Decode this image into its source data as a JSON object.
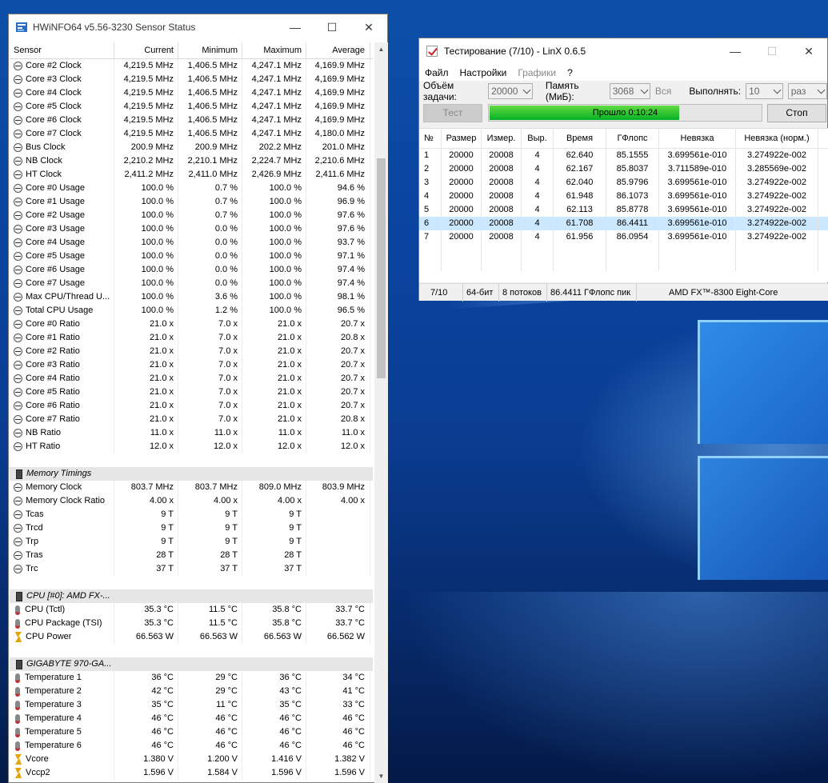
{
  "hwinfo": {
    "title": "HWiNFO64 v5.56-3230 Sensor Status",
    "columns": [
      "Sensor",
      "Current",
      "Minimum",
      "Maximum",
      "Average"
    ],
    "rows": [
      {
        "icon": "gauge",
        "name": "Core #2 Clock",
        "cur": "4,219.5 MHz",
        "min": "1,406.5 MHz",
        "max": "4,247.1 MHz",
        "avg": "4,169.9 MHz"
      },
      {
        "icon": "gauge",
        "name": "Core #3 Clock",
        "cur": "4,219.5 MHz",
        "min": "1,406.5 MHz",
        "max": "4,247.1 MHz",
        "avg": "4,169.9 MHz"
      },
      {
        "icon": "gauge",
        "name": "Core #4 Clock",
        "cur": "4,219.5 MHz",
        "min": "1,406.5 MHz",
        "max": "4,247.1 MHz",
        "avg": "4,169.9 MHz"
      },
      {
        "icon": "gauge",
        "name": "Core #5 Clock",
        "cur": "4,219.5 MHz",
        "min": "1,406.5 MHz",
        "max": "4,247.1 MHz",
        "avg": "4,169.9 MHz"
      },
      {
        "icon": "gauge",
        "name": "Core #6 Clock",
        "cur": "4,219.5 MHz",
        "min": "1,406.5 MHz",
        "max": "4,247.1 MHz",
        "avg": "4,169.9 MHz"
      },
      {
        "icon": "gauge",
        "name": "Core #7 Clock",
        "cur": "4,219.5 MHz",
        "min": "1,406.5 MHz",
        "max": "4,247.1 MHz",
        "avg": "4,180.0 MHz"
      },
      {
        "icon": "gauge",
        "name": "Bus Clock",
        "cur": "200.9 MHz",
        "min": "200.9 MHz",
        "max": "202.2 MHz",
        "avg": "201.0 MHz"
      },
      {
        "icon": "gauge",
        "name": "NB Clock",
        "cur": "2,210.2 MHz",
        "min": "2,210.1 MHz",
        "max": "2,224.7 MHz",
        "avg": "2,210.6 MHz"
      },
      {
        "icon": "gauge",
        "name": "HT Clock",
        "cur": "2,411.2 MHz",
        "min": "2,411.0 MHz",
        "max": "2,426.9 MHz",
        "avg": "2,411.6 MHz"
      },
      {
        "icon": "gauge",
        "name": "Core #0 Usage",
        "cur": "100.0 %",
        "min": "0.7 %",
        "max": "100.0 %",
        "avg": "94.6 %"
      },
      {
        "icon": "gauge",
        "name": "Core #1 Usage",
        "cur": "100.0 %",
        "min": "0.7 %",
        "max": "100.0 %",
        "avg": "96.9 %"
      },
      {
        "icon": "gauge",
        "name": "Core #2 Usage",
        "cur": "100.0 %",
        "min": "0.7 %",
        "max": "100.0 %",
        "avg": "97.6 %"
      },
      {
        "icon": "gauge",
        "name": "Core #3 Usage",
        "cur": "100.0 %",
        "min": "0.0 %",
        "max": "100.0 %",
        "avg": "97.6 %"
      },
      {
        "icon": "gauge",
        "name": "Core #4 Usage",
        "cur": "100.0 %",
        "min": "0.0 %",
        "max": "100.0 %",
        "avg": "93.7 %"
      },
      {
        "icon": "gauge",
        "name": "Core #5 Usage",
        "cur": "100.0 %",
        "min": "0.0 %",
        "max": "100.0 %",
        "avg": "97.1 %"
      },
      {
        "icon": "gauge",
        "name": "Core #6 Usage",
        "cur": "100.0 %",
        "min": "0.0 %",
        "max": "100.0 %",
        "avg": "97.4 %"
      },
      {
        "icon": "gauge",
        "name": "Core #7 Usage",
        "cur": "100.0 %",
        "min": "0.0 %",
        "max": "100.0 %",
        "avg": "97.4 %"
      },
      {
        "icon": "gauge",
        "name": "Max CPU/Thread U...",
        "cur": "100.0 %",
        "min": "3.6 %",
        "max": "100.0 %",
        "avg": "98.1 %"
      },
      {
        "icon": "gauge",
        "name": "Total CPU Usage",
        "cur": "100.0 %",
        "min": "1.2 %",
        "max": "100.0 %",
        "avg": "96.5 %"
      },
      {
        "icon": "gauge",
        "name": "Core #0 Ratio",
        "cur": "21.0 x",
        "min": "7.0 x",
        "max": "21.0 x",
        "avg": "20.7 x"
      },
      {
        "icon": "gauge",
        "name": "Core #1 Ratio",
        "cur": "21.0 x",
        "min": "7.0 x",
        "max": "21.0 x",
        "avg": "20.8 x"
      },
      {
        "icon": "gauge",
        "name": "Core #2 Ratio",
        "cur": "21.0 x",
        "min": "7.0 x",
        "max": "21.0 x",
        "avg": "20.7 x"
      },
      {
        "icon": "gauge",
        "name": "Core #3 Ratio",
        "cur": "21.0 x",
        "min": "7.0 x",
        "max": "21.0 x",
        "avg": "20.7 x"
      },
      {
        "icon": "gauge",
        "name": "Core #4 Ratio",
        "cur": "21.0 x",
        "min": "7.0 x",
        "max": "21.0 x",
        "avg": "20.7 x"
      },
      {
        "icon": "gauge",
        "name": "Core #5 Ratio",
        "cur": "21.0 x",
        "min": "7.0 x",
        "max": "21.0 x",
        "avg": "20.7 x"
      },
      {
        "icon": "gauge",
        "name": "Core #6 Ratio",
        "cur": "21.0 x",
        "min": "7.0 x",
        "max": "21.0 x",
        "avg": "20.7 x"
      },
      {
        "icon": "gauge",
        "name": "Core #7 Ratio",
        "cur": "21.0 x",
        "min": "7.0 x",
        "max": "21.0 x",
        "avg": "20.8 x"
      },
      {
        "icon": "gauge",
        "name": "NB Ratio",
        "cur": "11.0 x",
        "min": "11.0 x",
        "max": "11.0 x",
        "avg": "11.0 x"
      },
      {
        "icon": "gauge",
        "name": "HT Ratio",
        "cur": "12.0 x",
        "min": "12.0 x",
        "max": "12.0 x",
        "avg": "12.0 x"
      },
      {
        "type": "blank"
      },
      {
        "type": "group",
        "icon": "chip",
        "name": "Memory Timings"
      },
      {
        "icon": "gauge",
        "name": "Memory Clock",
        "cur": "803.7 MHz",
        "min": "803.7 MHz",
        "max": "809.0 MHz",
        "avg": "803.9 MHz"
      },
      {
        "icon": "gauge",
        "name": "Memory Clock Ratio",
        "cur": "4.00 x",
        "min": "4.00 x",
        "max": "4.00 x",
        "avg": "4.00 x"
      },
      {
        "icon": "gauge",
        "name": "Tcas",
        "cur": "9 T",
        "min": "9 T",
        "max": "9 T",
        "avg": ""
      },
      {
        "icon": "gauge",
        "name": "Trcd",
        "cur": "9 T",
        "min": "9 T",
        "max": "9 T",
        "avg": ""
      },
      {
        "icon": "gauge",
        "name": "Trp",
        "cur": "9 T",
        "min": "9 T",
        "max": "9 T",
        "avg": ""
      },
      {
        "icon": "gauge",
        "name": "Tras",
        "cur": "28 T",
        "min": "28 T",
        "max": "28 T",
        "avg": ""
      },
      {
        "icon": "gauge",
        "name": "Trc",
        "cur": "37 T",
        "min": "37 T",
        "max": "37 T",
        "avg": ""
      },
      {
        "type": "blank"
      },
      {
        "type": "group",
        "icon": "chip",
        "name": "CPU [#0]: AMD FX-..."
      },
      {
        "icon": "thermo",
        "name": "CPU (Tctl)",
        "cur": "35.3 °C",
        "min": "11.5 °C",
        "max": "35.8 °C",
        "avg": "33.7 °C"
      },
      {
        "icon": "thermo",
        "name": "CPU Package (TSI)",
        "cur": "35.3 °C",
        "min": "11.5 °C",
        "max": "35.8 °C",
        "avg": "33.7 °C"
      },
      {
        "icon": "bolt",
        "name": "CPU Power",
        "cur": "66.563 W",
        "min": "66.563 W",
        "max": "66.563 W",
        "avg": "66.562 W"
      },
      {
        "type": "blank"
      },
      {
        "type": "group",
        "icon": "chip",
        "name": "GIGABYTE 970-GA..."
      },
      {
        "icon": "thermo",
        "name": "Temperature 1",
        "cur": "36 °C",
        "min": "29 °C",
        "max": "36 °C",
        "avg": "34 °C"
      },
      {
        "icon": "thermo",
        "name": "Temperature 2",
        "cur": "42 °C",
        "min": "29 °C",
        "max": "43 °C",
        "avg": "41 °C"
      },
      {
        "icon": "thermo",
        "name": "Temperature 3",
        "cur": "35 °C",
        "min": "11 °C",
        "max": "35 °C",
        "avg": "33 °C"
      },
      {
        "icon": "thermo",
        "name": "Temperature 4",
        "cur": "46 °C",
        "min": "46 °C",
        "max": "46 °C",
        "avg": "46 °C"
      },
      {
        "icon": "thermo",
        "name": "Temperature 5",
        "cur": "46 °C",
        "min": "46 °C",
        "max": "46 °C",
        "avg": "46 °C"
      },
      {
        "icon": "thermo",
        "name": "Temperature 6",
        "cur": "46 °C",
        "min": "46 °C",
        "max": "46 °C",
        "avg": "46 °C"
      },
      {
        "icon": "bolt",
        "name": "Vcore",
        "cur": "1.380 V",
        "min": "1.200 V",
        "max": "1.416 V",
        "avg": "1.382 V"
      },
      {
        "icon": "bolt",
        "name": "Vccp2",
        "cur": "1.596 V",
        "min": "1.584 V",
        "max": "1.596 V",
        "avg": "1.596 V"
      }
    ]
  },
  "linx": {
    "title": "Тестирование (7/10) - LinX 0.6.5",
    "menu": [
      "Файл",
      "Настройки",
      "Графики",
      "?"
    ],
    "options": {
      "task_label": "Объём задачи:",
      "task_value": "20000",
      "memory_label": "Память (МиБ):",
      "memory_value": "3068",
      "all_label": "Вся",
      "run_label": "Выполнять:",
      "run_value": "10",
      "run_unit": "раз"
    },
    "test_button": "Тест",
    "stop_button": "Стоп",
    "progress": {
      "text": "Прошло 0:10:24",
      "fraction": 0.7,
      "color": "#06b025"
    },
    "columns": [
      "№",
      "Размер",
      "Измер.",
      "Выр.",
      "Время",
      "ГФлопс",
      "Невязка",
      "Невязка (норм.)"
    ],
    "rows": [
      [
        "1",
        "20000",
        "20008",
        "4",
        "62.640",
        "85.1555",
        "3.699561e-010",
        "3.274922e-002"
      ],
      [
        "2",
        "20000",
        "20008",
        "4",
        "62.167",
        "85.8037",
        "3.711589e-010",
        "3.285569e-002"
      ],
      [
        "3",
        "20000",
        "20008",
        "4",
        "62.040",
        "85.9796",
        "3.699561e-010",
        "3.274922e-002"
      ],
      [
        "4",
        "20000",
        "20008",
        "4",
        "61.948",
        "86.1073",
        "3.699561e-010",
        "3.274922e-002"
      ],
      [
        "5",
        "20000",
        "20008",
        "4",
        "62.113",
        "85.8778",
        "3.699561e-010",
        "3.274922e-002"
      ],
      [
        "6",
        "20000",
        "20008",
        "4",
        "61.708",
        "86.4411",
        "3.699561e-010",
        "3.274922e-002"
      ],
      [
        "7",
        "20000",
        "20008",
        "4",
        "61.956",
        "86.0954",
        "3.699561e-010",
        "3.274922e-002"
      ]
    ],
    "selected_row": 5,
    "status": [
      "7/10",
      "64-бит",
      "8 потоков",
      "86.4411 ГФлопс пик",
      "AMD FX™-8300 Eight-Core"
    ]
  }
}
